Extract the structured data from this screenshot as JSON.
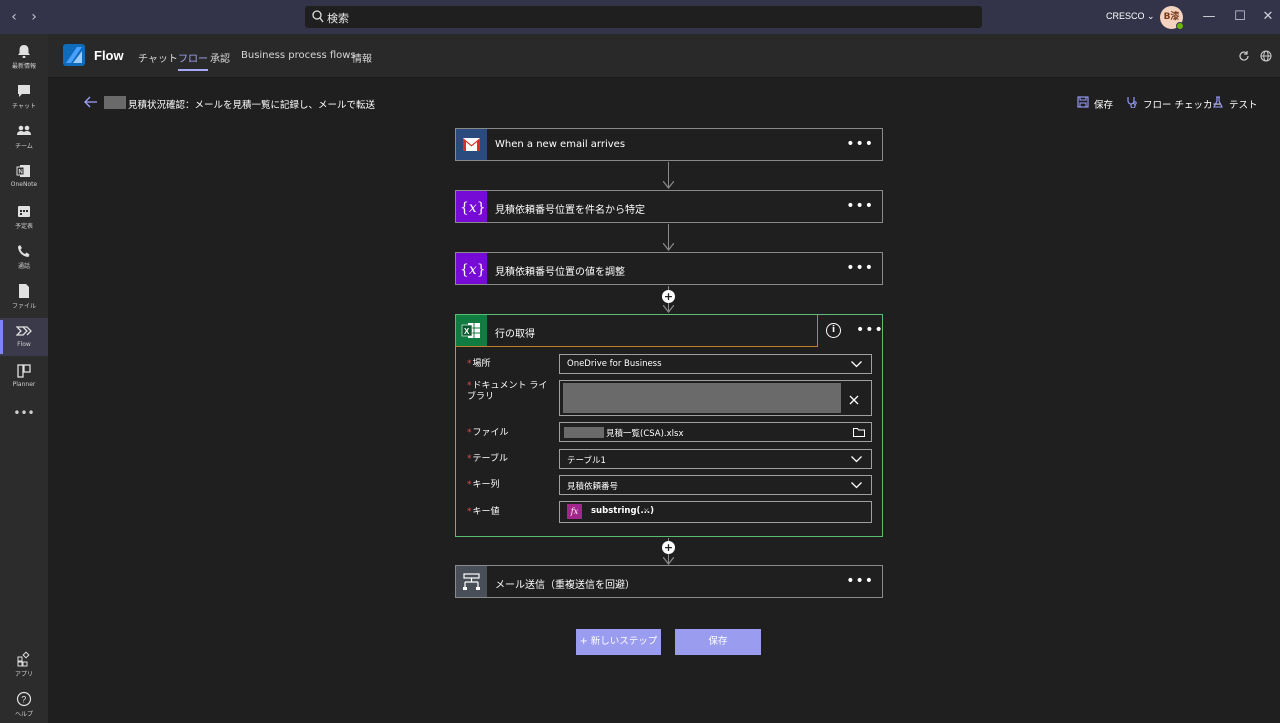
{
  "titlebar": {
    "back": "‹",
    "forward": "›",
    "search_label": "検索",
    "org": "CRESCO ⌄",
    "avatar_initials": "B漆",
    "minimize": "—",
    "maximize": "☐",
    "close": "✕"
  },
  "rail": {
    "items": [
      {
        "label": "最新情報"
      },
      {
        "label": "チャット"
      },
      {
        "label": "チーム"
      },
      {
        "label": "OneNote"
      },
      {
        "label": "予定表"
      },
      {
        "label": "通話"
      },
      {
        "label": "ファイル"
      },
      {
        "label": "Flow"
      },
      {
        "label": "Planner"
      },
      {
        "label": "アプリ"
      },
      {
        "label": "ヘルプ"
      }
    ],
    "more": "•••"
  },
  "app": {
    "name": "Flow",
    "tabs": [
      "チャット",
      "フロー",
      "承認",
      "Business process flows",
      "情報"
    ],
    "active_tab": "フロー"
  },
  "subheader": {
    "title": "見積状況確認：メールを見積一覧に記録し、メールで転送",
    "save": "保存",
    "checker": "フロー チェッカー",
    "test": "テスト"
  },
  "steps": [
    {
      "title": "When a new email arrives",
      "icon": "gmail-icon"
    },
    {
      "title": "見積依頼番号位置を件名から特定",
      "icon": "variable-icon"
    },
    {
      "title": "見積依頼番号位置の値を調整",
      "icon": "variable-icon"
    }
  ],
  "expanded": {
    "title": "行の取得",
    "icon": "excel-icon",
    "fields": {
      "location_label": "場所",
      "location_value": "OneDrive for Business",
      "library_label": "ドキュメント ライブラリ",
      "file_label": "ファイル",
      "file_value": "見積一覧(CSA).xlsx",
      "table_label": "テーブル",
      "table_value": "テーブル1",
      "keycol_label": "キー列",
      "keycol_value": "見積依頼番号",
      "keyval_label": "キー値",
      "keyval_token": "substring(...)"
    }
  },
  "last_step": {
    "title": "メール送信（重複送信を回避）",
    "icon": "control-icon"
  },
  "buttons": {
    "new_step": "+ 新しいステップ",
    "save": "保存"
  },
  "colors": {
    "accent": "#7f85f5",
    "titlebar": "#33344a",
    "excel": "#107c41",
    "variable": "#770bd6",
    "expression": "#a4268b",
    "active_border": "#5bbd72"
  }
}
